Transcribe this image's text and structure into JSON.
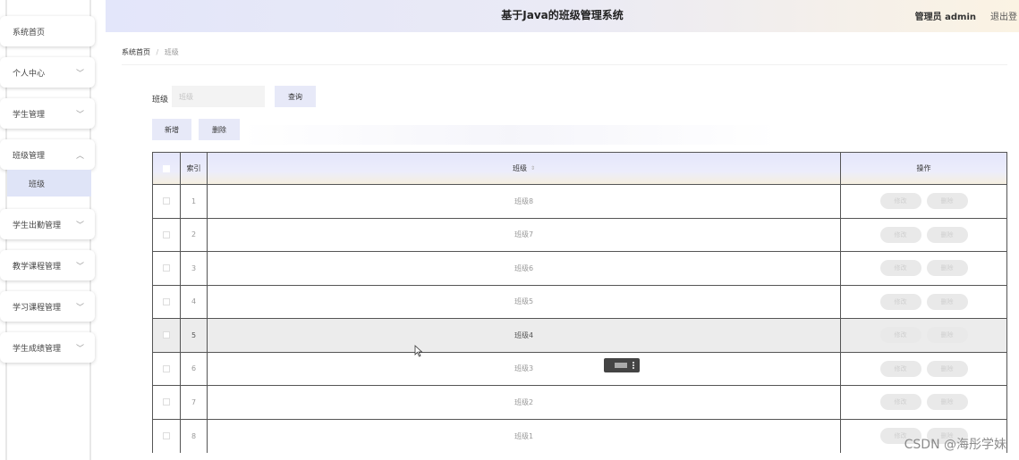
{
  "header": {
    "title": "基于Java的班级管理系统",
    "user": "管理员 admin",
    "logout": "退出登"
  },
  "sidebar": {
    "items": [
      {
        "label": "系统首页",
        "chevron": ""
      },
      {
        "label": "个人中心",
        "chevron": "﹀"
      },
      {
        "label": "学生管理",
        "chevron": "﹀"
      },
      {
        "label": "班级管理",
        "chevron": "︿"
      },
      {
        "label": "学生出勤管理",
        "chevron": "﹀"
      },
      {
        "label": "教学课程管理",
        "chevron": "﹀"
      },
      {
        "label": "学习课程管理",
        "chevron": "﹀"
      },
      {
        "label": "学生成绩管理",
        "chevron": "﹀"
      }
    ],
    "submenu": {
      "label": "班级"
    }
  },
  "breadcrumb": {
    "home": "系统首页",
    "separator": "/",
    "current": "班级"
  },
  "search": {
    "label": "班级",
    "placeholder": "班级",
    "button": "查询"
  },
  "actions": {
    "add": "新增",
    "delete": "删除"
  },
  "table": {
    "headers": {
      "index": "索引",
      "name": "班级",
      "sort": "⇕",
      "operations": "操作"
    },
    "rows": [
      {
        "index": "1",
        "name": "班级8"
      },
      {
        "index": "2",
        "name": "班级7"
      },
      {
        "index": "3",
        "name": "班级6"
      },
      {
        "index": "4",
        "name": "班级5"
      },
      {
        "index": "5",
        "name": "班级4"
      },
      {
        "index": "6",
        "name": "班级3"
      },
      {
        "index": "7",
        "name": "班级2"
      },
      {
        "index": "8",
        "name": "班级1"
      }
    ],
    "row_buttons": {
      "edit": "修改",
      "delete": "删除"
    },
    "hovered_row": 5
  },
  "watermark": "CSDN @海彤学妹",
  "colors": {
    "header_gradient_start": "#e3e6fa",
    "header_gradient_end": "#fbf3e3",
    "button_bg": "#e7e9f8",
    "submenu_active_bg": "#dfe4f7",
    "row_hover_bg": "#ececec"
  }
}
